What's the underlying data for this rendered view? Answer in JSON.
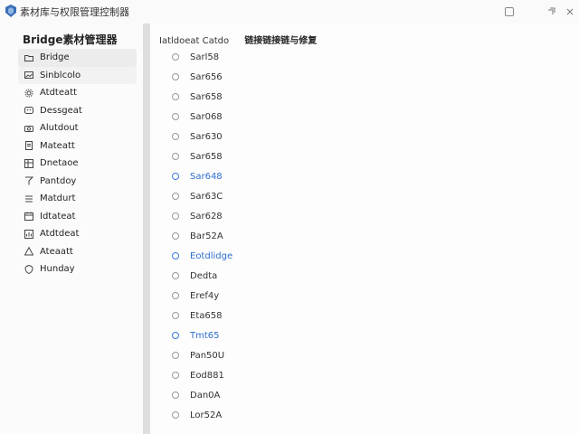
{
  "window": {
    "title": "素材库与权限管理控制器"
  },
  "sidebar": {
    "title": "Bridge素材管理器",
    "items": [
      {
        "label": "Bridge",
        "icon": "folder-icon",
        "state": "selected"
      },
      {
        "label": "Sinblcolo",
        "icon": "image-icon",
        "state": "subtle"
      },
      {
        "label": "Atdteatt",
        "icon": "gear-icon",
        "state": ""
      },
      {
        "label": "Dessgeat",
        "icon": "palette-icon",
        "state": ""
      },
      {
        "label": "Alutdout",
        "icon": "camera-icon",
        "state": ""
      },
      {
        "label": "Mateatt",
        "icon": "document-icon",
        "state": ""
      },
      {
        "label": "Dnetaoe",
        "icon": "grid-icon",
        "state": ""
      },
      {
        "label": "Pantdoy",
        "icon": "pin-icon",
        "state": ""
      },
      {
        "label": "Matdurt",
        "icon": "list-icon",
        "state": ""
      },
      {
        "label": "Idtateat",
        "icon": "calendar-icon",
        "state": ""
      },
      {
        "label": "Atdtdeat",
        "icon": "chart-icon",
        "state": ""
      },
      {
        "label": "Ateaatt",
        "icon": "warning-icon",
        "state": ""
      },
      {
        "label": "Hunday",
        "icon": "shield-icon",
        "state": ""
      }
    ]
  },
  "main": {
    "header_left": "Iatldoeat Catdo",
    "header_title": "链接链接链与修复",
    "items": [
      {
        "label": "Sarl58",
        "accent": false
      },
      {
        "label": "Sar656",
        "accent": false
      },
      {
        "label": "Sar658",
        "accent": false
      },
      {
        "label": "Sar068",
        "accent": false
      },
      {
        "label": "Sar630",
        "accent": false
      },
      {
        "label": "Sar658",
        "accent": false
      },
      {
        "label": "Sar648",
        "accent": true
      },
      {
        "label": "Sar63C",
        "accent": false
      },
      {
        "label": "Sar628",
        "accent": false
      },
      {
        "label": "Bar52A",
        "accent": false
      },
      {
        "label": "Eotdlidge",
        "accent": true
      },
      {
        "label": "Dedta",
        "accent": false
      },
      {
        "label": "Eref4y",
        "accent": false
      },
      {
        "label": "Eta658",
        "accent": false
      },
      {
        "label": "Tmt65",
        "accent": true
      },
      {
        "label": "Pan50U",
        "accent": false
      },
      {
        "label": "Eod881",
        "accent": false
      },
      {
        "label": "Dan0A",
        "accent": false
      },
      {
        "label": "Lor52A",
        "accent": false
      }
    ]
  },
  "colors": {
    "accent": "#2f6fcf",
    "app_icon": "#3b6fb6"
  }
}
